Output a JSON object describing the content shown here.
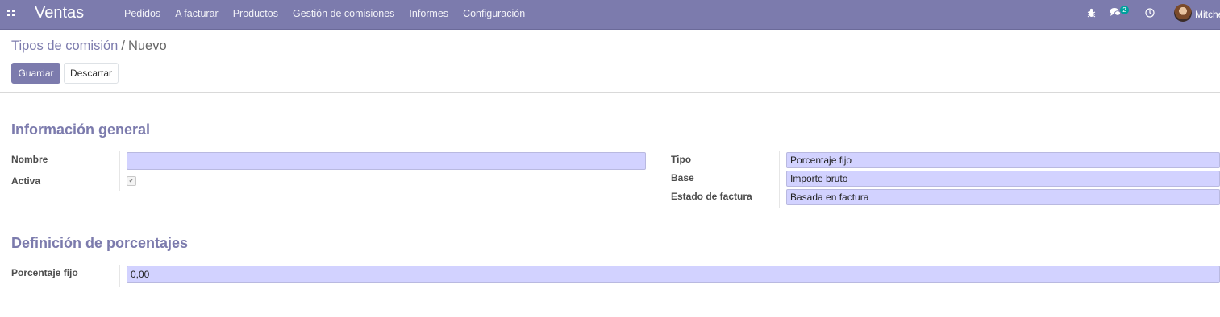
{
  "navbar": {
    "app_name": "Ventas",
    "menu": [
      "Pedidos",
      "A facturar",
      "Productos",
      "Gestión de comisiones",
      "Informes",
      "Configuración"
    ],
    "systray": {
      "bug_icon": "bug-icon",
      "chat_icon": "chat-icon",
      "chat_badge": "2",
      "clock_icon": "clock-icon"
    },
    "user_name": "Mitche"
  },
  "breadcrumb": {
    "parent": "Tipos de comisión",
    "separator": "/",
    "current": "Nuevo"
  },
  "buttons": {
    "save": "Guardar",
    "discard": "Descartar"
  },
  "sections": {
    "general": "Información general",
    "percentages": "Definición de porcentajes"
  },
  "fields": {
    "name": {
      "label": "Nombre",
      "value": ""
    },
    "active": {
      "label": "Activa",
      "checked": true
    },
    "type": {
      "label": "Tipo",
      "value": "Porcentaje fijo"
    },
    "base": {
      "label": "Base",
      "value": "Importe bruto"
    },
    "invoice_state": {
      "label": "Estado de factura",
      "value": "Basada en factura"
    },
    "fix_qty": {
      "label": "Porcentaje fijo",
      "value": "0,00"
    }
  },
  "colors": {
    "brand": "#7c7bad",
    "field_bg": "#d2d2ff",
    "badge": "#00a09d"
  }
}
